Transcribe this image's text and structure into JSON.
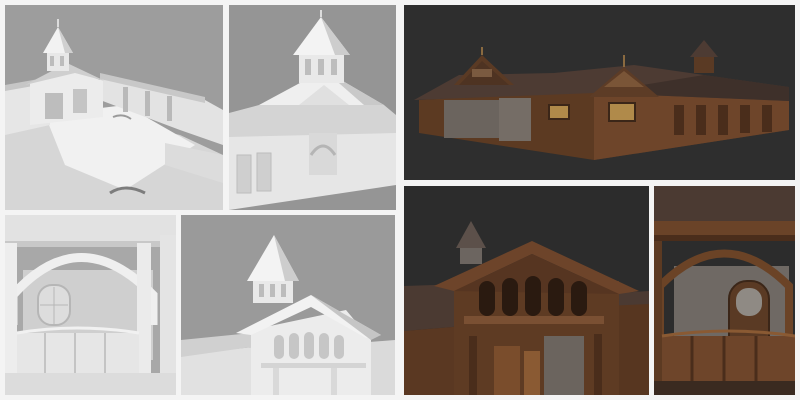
{
  "colors": {
    "page_border": "#f4f4f4",
    "clay_background": "#9b9b9b",
    "clay_light": "#eeeeee",
    "clay_mid": "#d2d2d2",
    "clay_shadow": "#b4b4b4",
    "render_background": "#2d2d2d",
    "wood_dark": "#4a2d1b",
    "wood_mid": "#6b4326",
    "wood_light": "#8a5a33",
    "roof_tile": "#4b3a32",
    "stone": "#6c6560",
    "window_glow": "#b08a4a"
  },
  "panels": [
    {
      "id": "clay-courtyard-overview",
      "style": "clay"
    },
    {
      "id": "clay-tower-closeup",
      "style": "clay"
    },
    {
      "id": "clay-archway-interior",
      "style": "clay"
    },
    {
      "id": "clay-gable-front",
      "style": "clay"
    },
    {
      "id": "textured-full-building",
      "style": "textured"
    },
    {
      "id": "textured-gable-front",
      "style": "textured"
    },
    {
      "id": "textured-archway-interior",
      "style": "textured"
    }
  ]
}
